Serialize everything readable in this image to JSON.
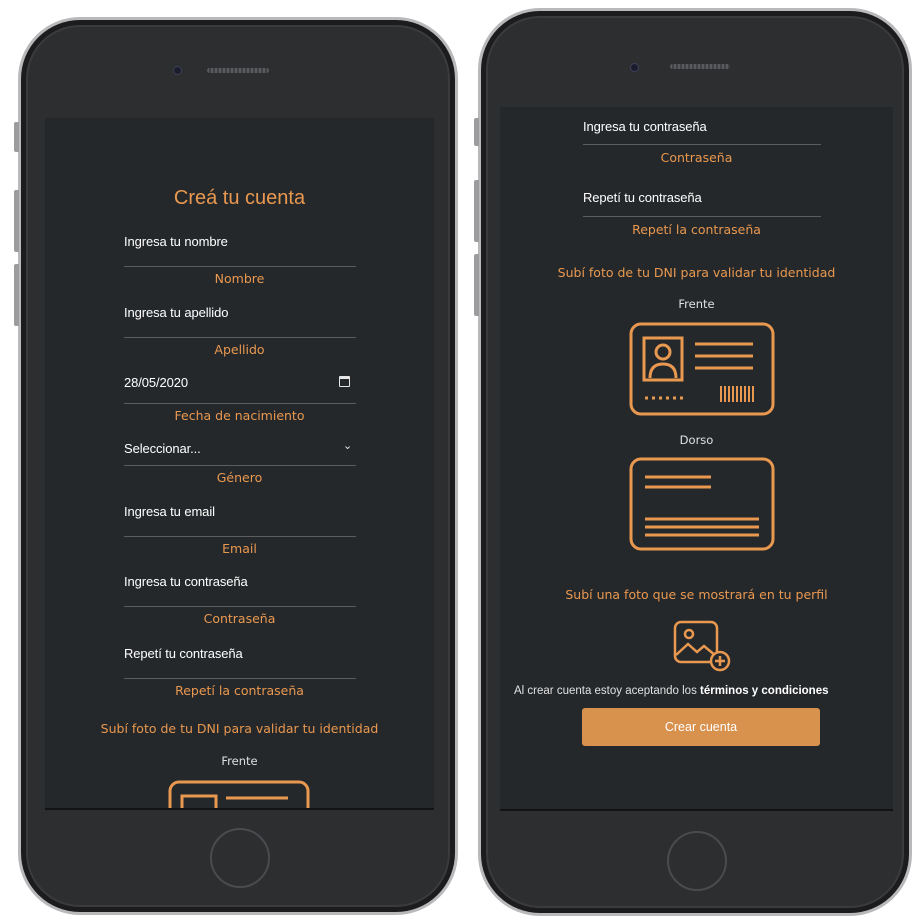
{
  "left": {
    "title": "Creá tu cuenta",
    "fields": [
      {
        "value": "Ingresa tu nombre",
        "caption": "Nombre"
      },
      {
        "value": "Ingresa tu apellido",
        "caption": "Apellido"
      },
      {
        "value": "28/05/2020",
        "caption": "Fecha de nacimiento"
      },
      {
        "value": "Seleccionar...",
        "caption": "Género"
      },
      {
        "value": "Ingresa tu email",
        "caption": "Email"
      },
      {
        "value": "Ingresa tu contraseña",
        "caption": "Contraseña"
      },
      {
        "value": "Repetí tu contraseña",
        "caption": "Repetí la contraseña"
      }
    ],
    "dni_text": "Subí foto de tu DNI para validar tu identidad",
    "front_label": "Frente"
  },
  "right": {
    "fields": [
      {
        "value": "Ingresa tu contraseña",
        "caption": "Contraseña"
      },
      {
        "value": "Repetí tu contraseña",
        "caption": "Repetí la contraseña"
      }
    ],
    "dni_text": "Subí foto de tu DNI para validar tu identidad",
    "front_label": "Frente",
    "back_label": "Dorso",
    "profile_text": "Subí una foto que se mostrará en tu perfil",
    "terms_prefix": "Al crear cuenta estoy aceptando los",
    "terms_link": "términos y condiciones",
    "cta_label": "Crear cuenta"
  },
  "colors": {
    "accent": "#e9984f",
    "button": "#d9914e",
    "screen_bg": "#25282b"
  },
  "icons": [
    "calendar-icon",
    "chevron-down-icon",
    "id-card-front-icon",
    "id-card-back-icon",
    "add-image-icon"
  ]
}
